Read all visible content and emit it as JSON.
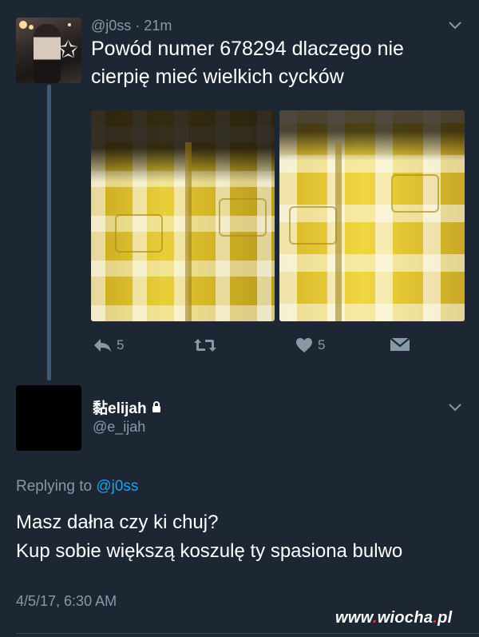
{
  "original_tweet": {
    "handle": "@j0ss",
    "time": "· 21m",
    "text": "Powód numer 678294 dlaczego nie cierpię mieć wielkich cycków",
    "actions": {
      "reply_count": "5",
      "like_count": "5"
    }
  },
  "reply_tweet": {
    "name": "黏elijah",
    "handle": "@e_ijah",
    "replying_label": "Replying to",
    "replying_to": "@j0ss",
    "line1": "Masz dałna czy ki chuj?",
    "line2": "Kup sobie większą koszulę ty spasiona bulwo",
    "timestamp": "4/5/17, 6:30 AM"
  },
  "watermark": {
    "prefix": "www",
    "dot": ".",
    "name": "wiocha",
    "dot2": ".",
    "tld": "pl"
  },
  "colors": {
    "background": "#1c2733",
    "secondary_text": "#8899a6",
    "mention": "#1da1f2",
    "thread_line": "#3f5a75"
  }
}
